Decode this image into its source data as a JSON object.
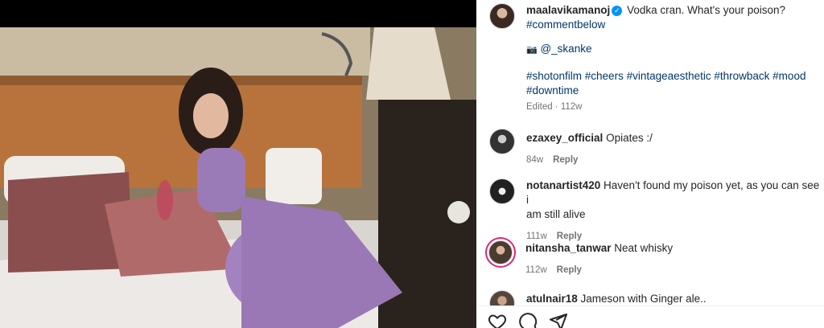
{
  "post": {
    "author": "maalavikamanoj",
    "caption_line1": "Vodka cran. What's your poison?",
    "caption_tag1": "#commentbelow",
    "mention_emoji": "📷",
    "mention": "@_skanke",
    "hashtags_line1": "#shotonfilm #cheers #vintageaesthetic #throwback #mood",
    "hashtags_line2": "#downtime",
    "edited": "Edited · 112w"
  },
  "comments": [
    {
      "user": "ezaxey_official",
      "text": "Opiates :/",
      "age": "84w",
      "reply": "Reply"
    },
    {
      "user": "notanartist420",
      "text1": "Haven't found my poison yet, as you can see i",
      "text2": "am still alive",
      "age": "111w",
      "reply": "Reply"
    },
    {
      "user": "nitansha_tanwar",
      "text": "Neat whisky",
      "age": "112w",
      "reply": "Reply"
    },
    {
      "user": "atulnair18",
      "text": "Jameson with Ginger ale.."
    }
  ],
  "icons": [
    "heart-icon",
    "comment-icon",
    "share-icon"
  ],
  "colors": {
    "link": "#00376b",
    "verified": "#0095f6",
    "muted": "#737373"
  }
}
